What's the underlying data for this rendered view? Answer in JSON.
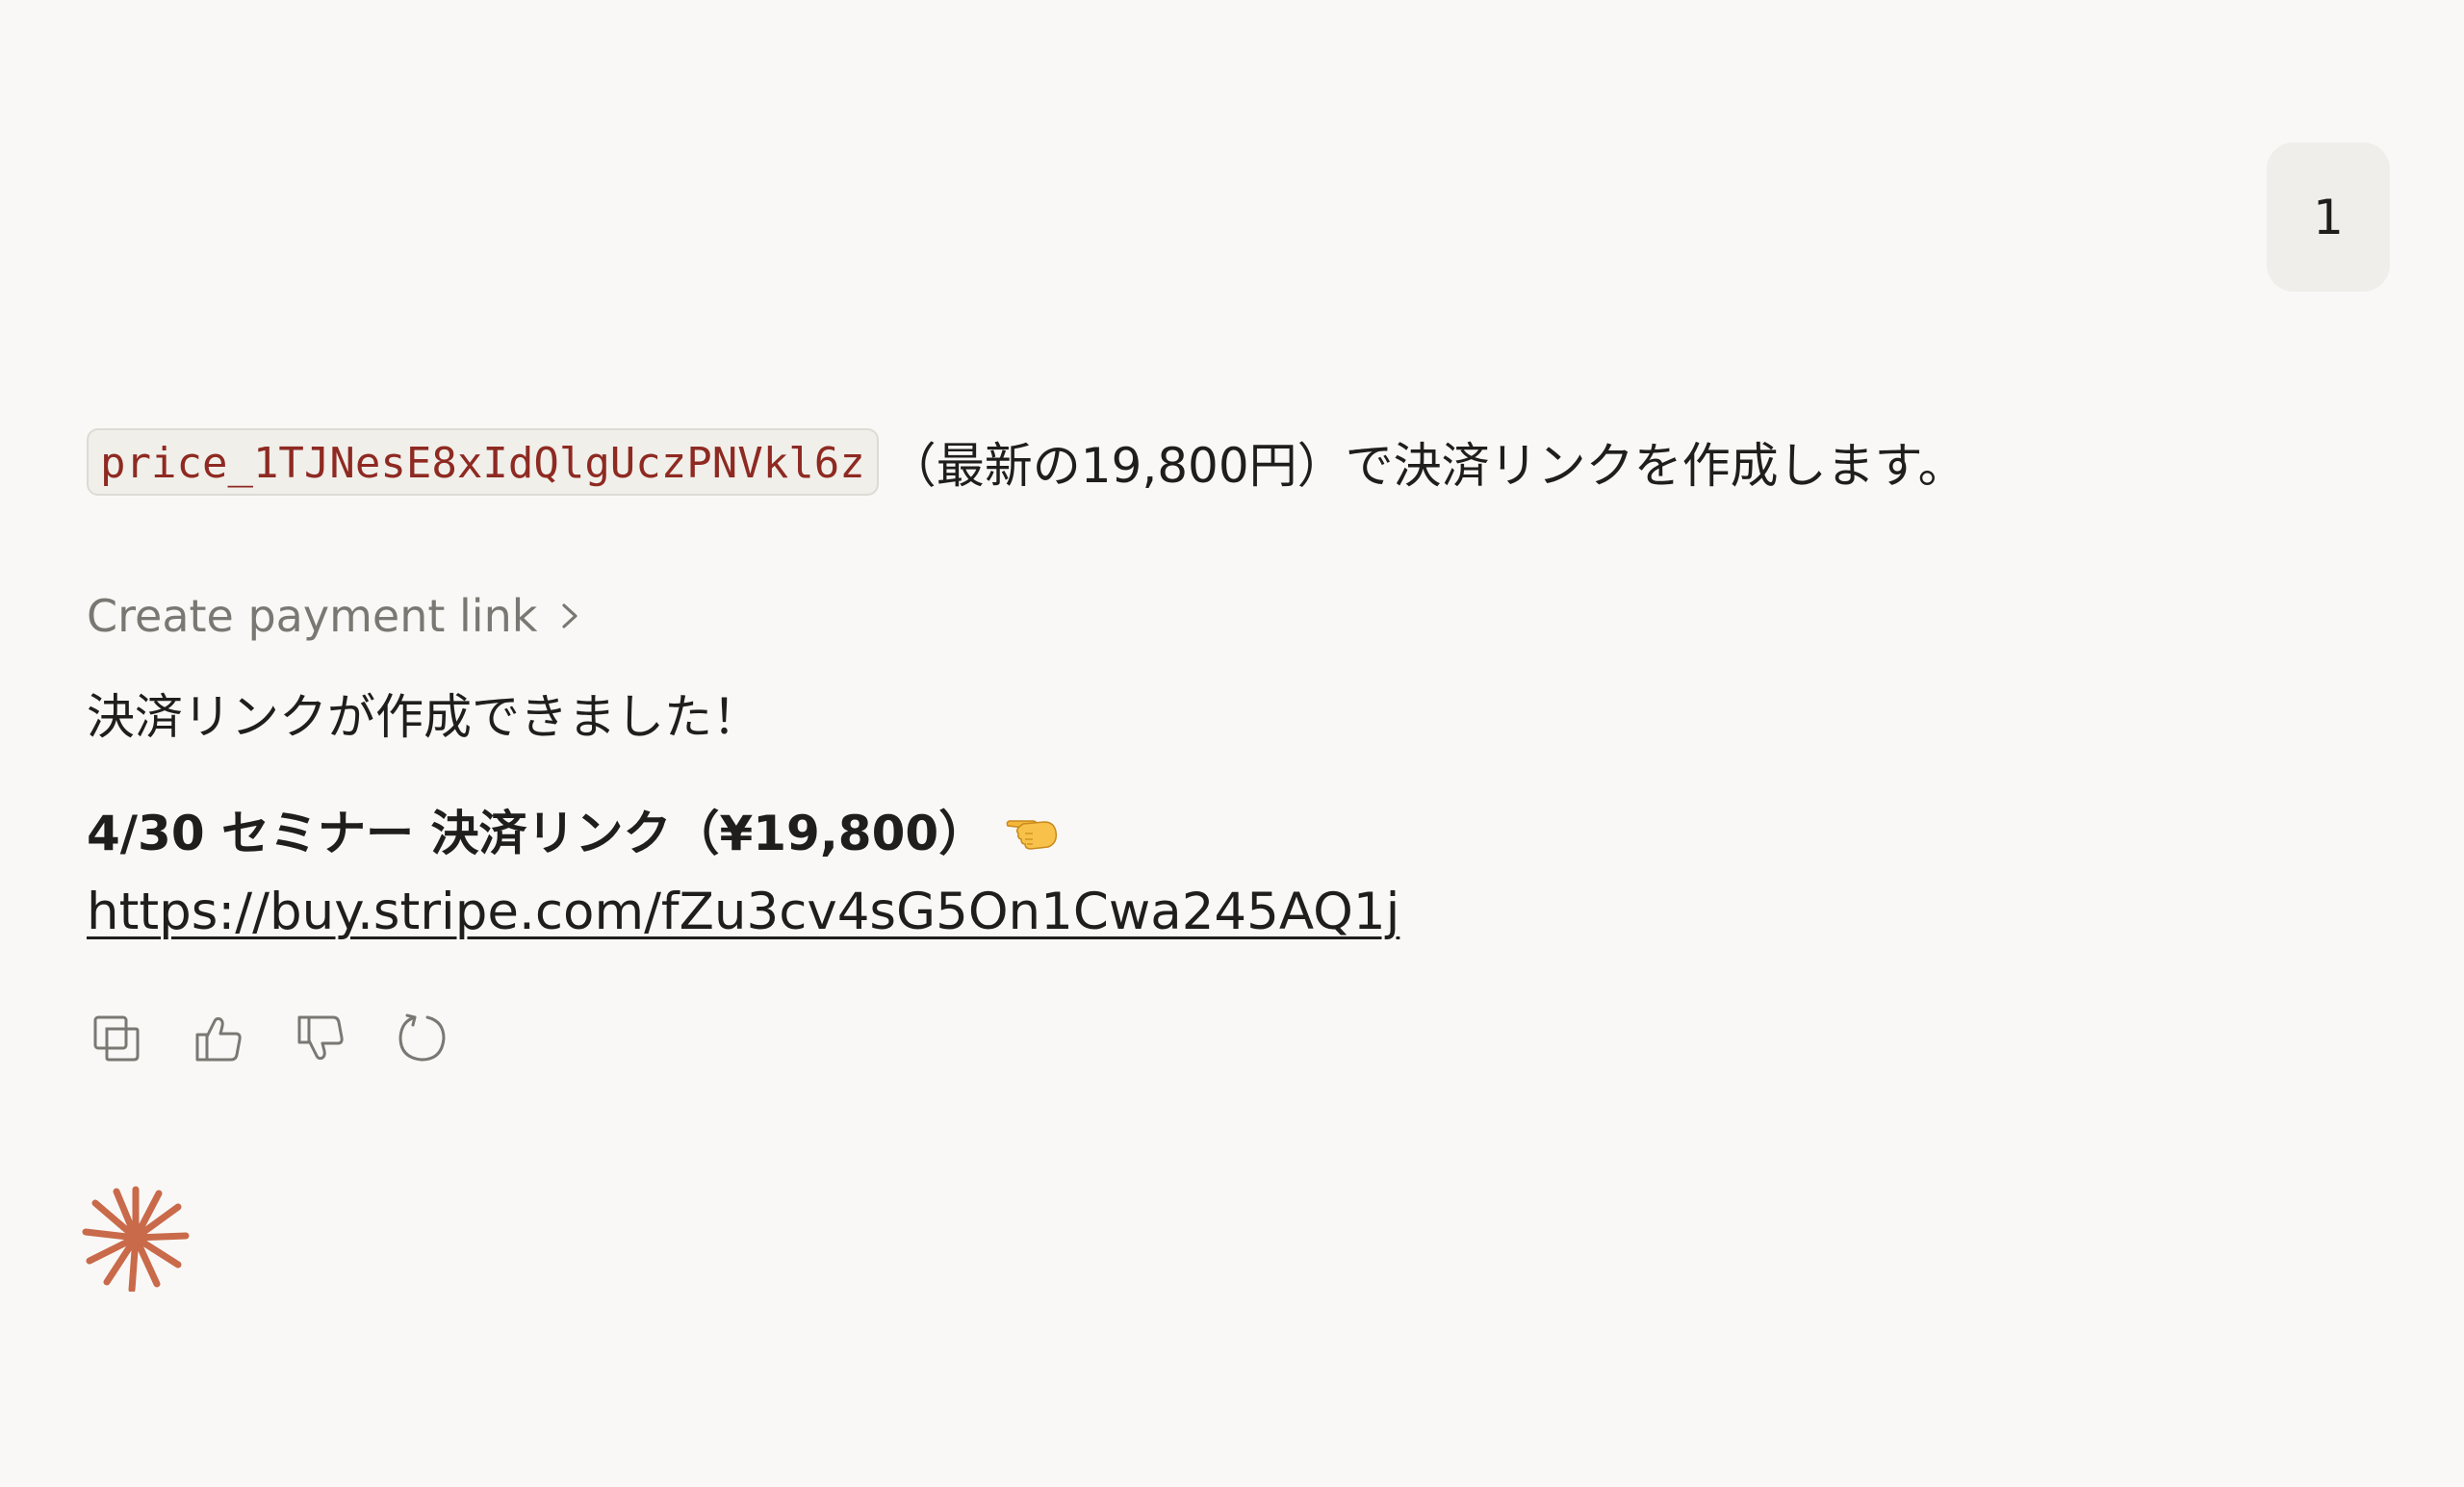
{
  "user_message": {
    "text": "1"
  },
  "assistant": {
    "intro": {
      "code": "price_1TJNesE8xIdQlgUczPNVkl6z",
      "text": "（最新の19,800円）で決済リンクを作成します。"
    },
    "tool_call": {
      "label": "Create payment link"
    },
    "result": {
      "success_text": "決済リンクが作成できました！",
      "link_title": "4/30 セミナー 決済リンク（¥19,800）",
      "link_url": "https://buy.stripe.com/fZu3cv4sG5On1Cwa245AQ1j"
    }
  },
  "icons": {
    "copy": "copy-icon",
    "thumbs_up": "thumbs-up-icon",
    "thumbs_down": "thumbs-down-icon",
    "retry": "retry-icon",
    "pointing": "backhand-index-pointing-left-emoji",
    "spark": "claude-spark-icon"
  },
  "colors": {
    "background": "#f9f8f6",
    "code_text": "#8e2a22",
    "spark": "#c96a4a"
  }
}
